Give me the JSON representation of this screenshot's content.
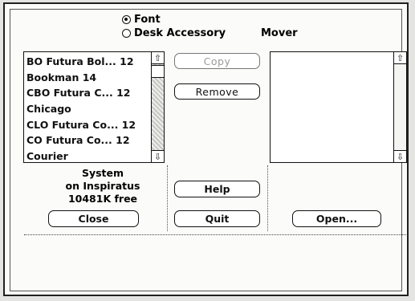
{
  "window": {
    "title": "Mover"
  },
  "mode": {
    "options": [
      {
        "label": "Font",
        "selected": true
      },
      {
        "label": "Desk Accessory",
        "selected": false
      }
    ]
  },
  "left_list": {
    "items": [
      "BO Futura Bol... 12",
      "Bookman 14",
      "CBO Futura C... 12",
      "Chicago",
      "CLO Futura Co... 12",
      "CO Futura Co... 12",
      "Courier"
    ],
    "scrollbar": {
      "up_icon": "arrow-up-icon",
      "down_icon": "arrow-down-icon"
    }
  },
  "right_list": {
    "items": []
  },
  "info": {
    "line1": "System",
    "line2": "on Inspiratus",
    "line3": "10481K free"
  },
  "buttons": {
    "copy": "Copy",
    "remove": "Remove",
    "help": "Help",
    "quit": "Quit",
    "close": "Close",
    "open": "Open..."
  },
  "colors": {
    "dialog_bg": "#fbfbf9",
    "frame": "#202020",
    "disabled_text": "#9a9a9a"
  }
}
